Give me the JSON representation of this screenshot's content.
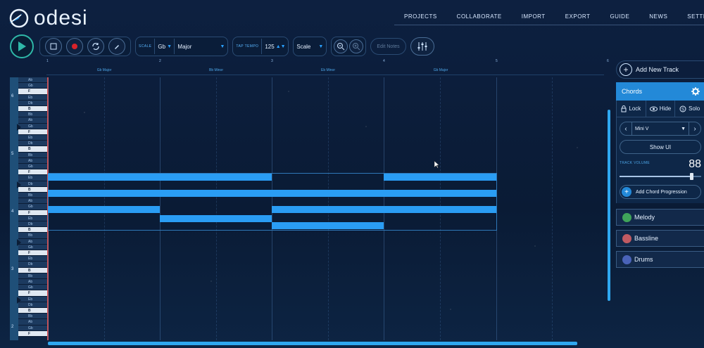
{
  "app": {
    "name": "odesi"
  },
  "nav": [
    "PROJECTS",
    "COLLABORATE",
    "IMPORT",
    "EXPORT",
    "GUIDE",
    "NEWS",
    "SETTINGS"
  ],
  "toolbar": {
    "scale_label": "SCALE",
    "key": "Gb",
    "mode": "Major",
    "tap_tempo_label": "TAP TEMPO",
    "tempo": "125",
    "snap": "Scale",
    "edit_notes": "Edit Notes"
  },
  "ruler": {
    "bars": [
      "1",
      "2",
      "3",
      "4",
      "5",
      "6"
    ],
    "chords": [
      "Gb Major",
      "Bb Minor",
      "Eb Minor",
      "Gb Major"
    ]
  },
  "piano": {
    "octaves": [
      "6",
      "5",
      "4",
      "3",
      "2"
    ],
    "key_labels": [
      "Ab",
      "Gb",
      "F",
      "Eb",
      "Db",
      "B",
      "Bb",
      "Ab",
      "Gb",
      "F",
      "Eb",
      "Db",
      "B",
      "Bb",
      "Ab",
      "Gb",
      "F",
      "Eb",
      "Db",
      "B",
      "Bb",
      "Ab",
      "Gb",
      "F",
      "Eb",
      "Db",
      "B",
      "Bb",
      "Ab",
      "Gb",
      "F",
      "Eb",
      "Db",
      "B",
      "Bb",
      "Ab",
      "Gb",
      "F",
      "Eb",
      "Db",
      "B",
      "Bb",
      "Ab",
      "Gb",
      "F"
    ]
  },
  "panel": {
    "add_track": "Add New Track",
    "active_track": {
      "name": "Chords",
      "lock": "Lock",
      "hide": "Hide",
      "solo": "Solo",
      "instrument": "Mini V",
      "show_ui": "Show UI",
      "volume_label": "TRACK VOLUME",
      "volume": "88",
      "volume_fraction": 0.88,
      "add_progression": "Add Chord Progression"
    },
    "tracks": [
      {
        "name": "Melody",
        "color": "#3fa45a"
      },
      {
        "name": "Bassline",
        "color": "#c05a62"
      },
      {
        "name": "Drums",
        "color": "#4a63b8"
      }
    ]
  },
  "colors": {
    "accent": "#2a9df4",
    "play": "#2fb8a8",
    "record": "#d8232a"
  }
}
